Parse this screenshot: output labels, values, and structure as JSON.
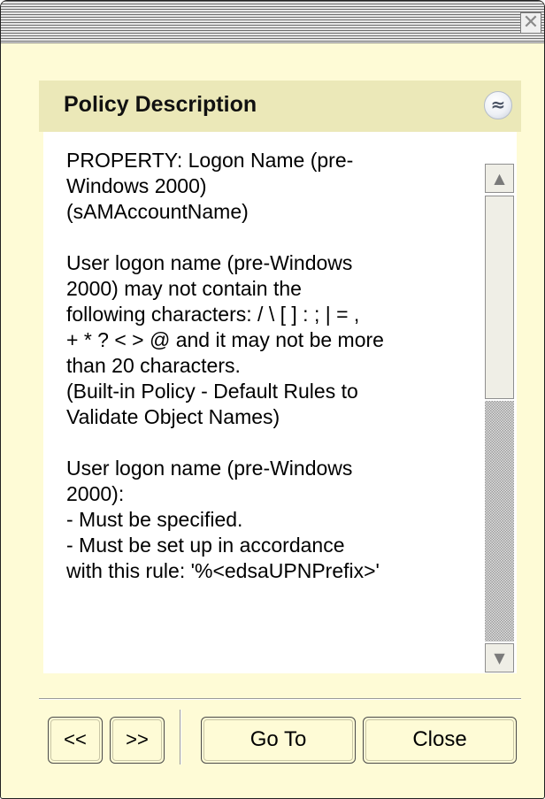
{
  "window": {
    "close_glyph": "✕"
  },
  "panel": {
    "title": "Policy Description",
    "collapse_glyph": "≈",
    "description": "PROPERTY: Logon Name (pre-\nWindows 2000)\n(sAMAccountName)\n\nUser logon name (pre-Windows\n2000) may not contain the\nfollowing characters: / \\ [ ] : ; | = ,\n+ * ? < > @ and it may not be more\nthan 20 characters.\n(Built-in Policy - Default Rules to\nValidate Object Names)\n\nUser logon name (pre-Windows\n2000):\n- Must be specified.\n- Must be set up in accordance\nwith this rule: '%<edsaUPNPrefix>'"
  },
  "scrollbar": {
    "up_glyph": "▲",
    "down_glyph": "▼",
    "position_fraction": 0.0,
    "visible_fraction": 0.45
  },
  "buttons": {
    "prev_label": "<<",
    "next_label": ">>",
    "goto_label": "Go To",
    "close_label": "Close"
  },
  "colors": {
    "window_bg": "#fefbd6",
    "header_bg": "#ebe8b8",
    "text": "#000000"
  }
}
